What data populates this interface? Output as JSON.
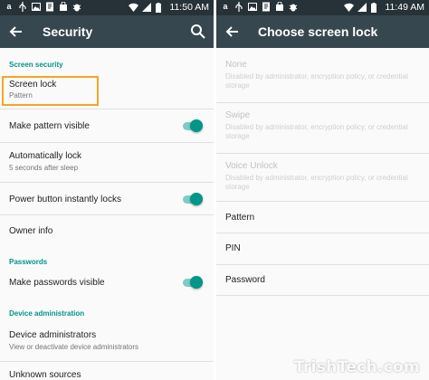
{
  "left": {
    "status": {
      "time": "11:50 AM"
    },
    "toolbar": {
      "title": "Security"
    },
    "sections": {
      "screen_security": "Screen security",
      "passwords": "Passwords",
      "device_admin": "Device administration"
    },
    "rows": {
      "screen_lock": {
        "label": "Screen lock",
        "sub": "Pattern"
      },
      "make_pattern_visible": {
        "label": "Make pattern visible",
        "on": true
      },
      "auto_lock": {
        "label": "Automatically lock",
        "sub": "5 seconds after sleep"
      },
      "power_button_locks": {
        "label": "Power button instantly locks",
        "on": true
      },
      "owner_info": {
        "label": "Owner info"
      },
      "make_passwords_visible": {
        "label": "Make passwords visible",
        "on": true
      },
      "device_admins": {
        "label": "Device administrators",
        "sub": "View or deactivate device administrators"
      },
      "unknown_sources": {
        "label": "Unknown sources"
      }
    }
  },
  "right": {
    "status": {
      "time": "11:49 AM"
    },
    "toolbar": {
      "title": "Choose screen lock"
    },
    "options": [
      {
        "label": "None",
        "sub": "Disabled by administrator, encryption policy, or credential storage",
        "disabled": true
      },
      {
        "label": "Swipe",
        "sub": "Disabled by administrator, encryption policy, or credential storage",
        "disabled": true
      },
      {
        "label": "Voice Unlock",
        "sub": "Disabled by administrator, encryption policy, or credential storage",
        "disabled": true
      },
      {
        "label": "Pattern",
        "disabled": false
      },
      {
        "label": "PIN",
        "disabled": false
      },
      {
        "label": "Password",
        "disabled": false
      }
    ]
  },
  "watermark": "TrishTech.com",
  "colors": {
    "statusbar": "#263238",
    "toolbar": "#37474f",
    "accent": "#009688",
    "toggle_track": "#80cbc4",
    "highlight": "#f5a524"
  }
}
